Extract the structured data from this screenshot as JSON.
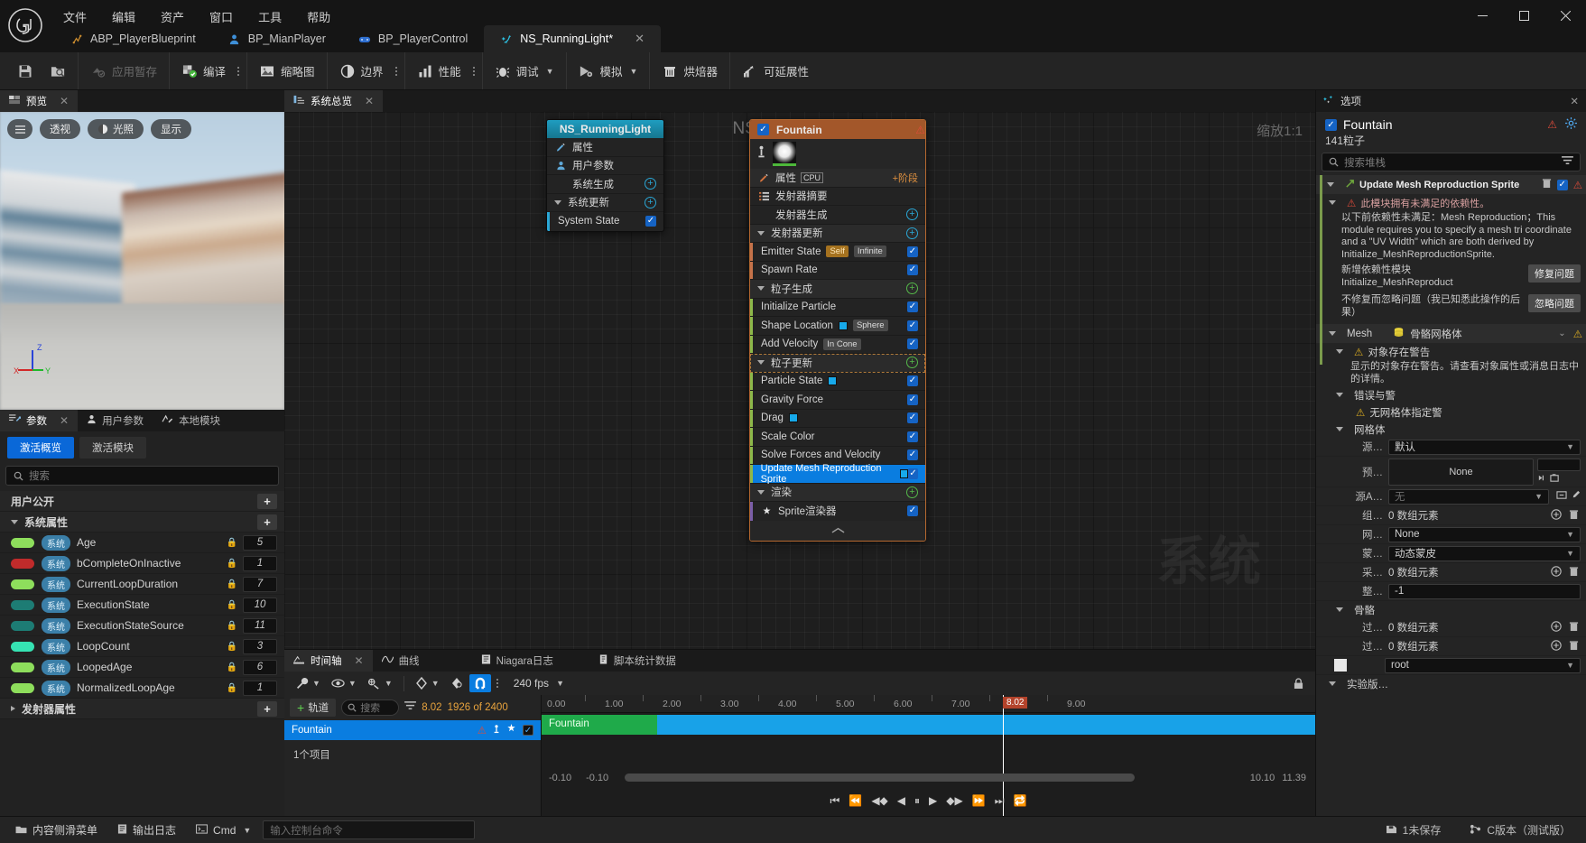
{
  "window": {
    "minimize": "—",
    "maximize": "▢",
    "close": "✕"
  },
  "menu": {
    "items": [
      {
        "label": "文件"
      },
      {
        "label": "编辑"
      },
      {
        "label": "资产"
      },
      {
        "label": "窗口"
      },
      {
        "label": "工具"
      },
      {
        "label": "帮助"
      }
    ]
  },
  "tabs": [
    {
      "label": "ABP_PlayerBlueprint",
      "icon": "anim-blueprint-icon",
      "active": false,
      "closable": false
    },
    {
      "label": "BP_MianPlayer",
      "icon": "blueprint-character-icon",
      "active": false,
      "closable": false
    },
    {
      "label": "BP_PlayerControl",
      "icon": "blueprint-controller-icon",
      "active": false,
      "closable": false
    },
    {
      "label": "NS_RunningLight*",
      "icon": "niagara-system-icon",
      "active": true,
      "closable": true,
      "close": "✕"
    }
  ],
  "toolbar": {
    "save_label": "",
    "save_icon": "save-icon",
    "browse_icon": "browse-to-asset-icon",
    "apply_label": "应用暂存",
    "apply_icon": "apply-scratch-icon",
    "compile_label": "编译",
    "compile_icon": "compile-check-icon",
    "thumbnail_label": "缩略图",
    "thumbnail_icon": "thumbnail-icon",
    "bounds_label": "边界",
    "bounds_icon": "bounds-icon",
    "performance_label": "性能",
    "performance_icon": "performance-bars-icon",
    "debug_label": "调试",
    "debug_icon": "debug-bug-icon",
    "simulate_label": "模拟",
    "simulate_icon": "simulate-play-icon",
    "baker_label": "烘焙器",
    "baker_icon": "baker-icon",
    "scalability_label": "可延展性",
    "scalability_icon": "scalability-graph-icon"
  },
  "preview": {
    "tab_label": "预览",
    "tab_icon": "viewport-icon",
    "close": "✕",
    "menu_icon": "hamburger-icon",
    "buttons": [
      {
        "label": "透视",
        "icon": ""
      },
      {
        "label": "光照",
        "icon": "lighting-icon"
      },
      {
        "label": "显示",
        "icon": ""
      }
    ],
    "axis": {
      "x": "X",
      "y": "Y",
      "z": "Z"
    }
  },
  "parameters": {
    "tabs": [
      {
        "label": "参数",
        "icon": "parameters-icon",
        "active": true,
        "close": "✕"
      },
      {
        "label": "用户参数",
        "icon": "user-icon",
        "active": false
      },
      {
        "label": "本地模块",
        "icon": "local-modules-icon",
        "active": false
      }
    ],
    "toggles": [
      {
        "label": "激活概览",
        "on": true
      },
      {
        "label": "激活模块",
        "on": false
      }
    ],
    "search_placeholder": "搜索",
    "search_icon": "search-icon",
    "sections": [
      {
        "title": "用户公开",
        "collapsed": true,
        "add": "+",
        "rows": []
      },
      {
        "title": "系统属性",
        "collapsed": false,
        "add": "+",
        "rows": [
          {
            "name": "Age",
            "tag": "系统",
            "color": "#8ede5c",
            "value": "5",
            "locked": true
          },
          {
            "name": "bCompleteOnInactive",
            "tag": "系统",
            "color": "#c02b2b",
            "value": "1",
            "locked": true
          },
          {
            "name": "CurrentLoopDuration",
            "tag": "系统",
            "color": "#8ede5c",
            "value": "7",
            "locked": true
          },
          {
            "name": "ExecutionState",
            "tag": "系统",
            "color": "#1d7c74",
            "value": "10",
            "locked": true
          },
          {
            "name": "ExecutionStateSource",
            "tag": "系统",
            "color": "#1d7c74",
            "value": "11",
            "locked": true
          },
          {
            "name": "LoopCount",
            "tag": "系统",
            "color": "#36e3b3",
            "value": "3",
            "locked": true
          },
          {
            "name": "LoopedAge",
            "tag": "系统",
            "color": "#8ede5c",
            "value": "6",
            "locked": true
          },
          {
            "name": "NormalizedLoopAge",
            "tag": "系统",
            "color": "#8ede5c",
            "value": "1",
            "locked": true
          }
        ]
      },
      {
        "title": "发射器属性",
        "collapsed": true,
        "add": "+",
        "rows": []
      }
    ]
  },
  "graph": {
    "tab_label": "系统总览",
    "tab_icon": "system-overview-icon",
    "close": "✕",
    "title": "NS_RunningLight",
    "zoom_label": "缩放1:1",
    "watermark": "系统",
    "system_node": {
      "title": "NS_RunningLight",
      "rows": [
        {
          "label": "属性",
          "icon": "pencil-icon",
          "type": "item"
        },
        {
          "label": "用户参数",
          "icon": "user-icon",
          "type": "item"
        },
        {
          "label": "系统生成",
          "icon": "",
          "type": "stage",
          "add": "+"
        },
        {
          "label": "系统更新",
          "icon": "",
          "type": "stage",
          "collapsed": false,
          "add": "+"
        },
        {
          "label": "System State",
          "icon": "",
          "type": "module",
          "checked": true
        }
      ]
    },
    "emitter_node": {
      "title": "Fountain",
      "checked": true,
      "warning_icon": "warning-triangle-icon",
      "thumbnail_icon": "particle-sprite-thumbnail",
      "rows": [
        {
          "label": "属性",
          "type": "item",
          "icon": "pencil-icon",
          "badge": "CPU",
          "stage_label": "阶段",
          "stage_add": "+"
        },
        {
          "label": "发射器摘要",
          "type": "item",
          "icon": "summary-icon"
        },
        {
          "label": "发射器生成",
          "type": "stage",
          "add": "+"
        },
        {
          "label": "发射器更新",
          "type": "stage",
          "collapsed": false,
          "add": "+"
        },
        {
          "label": "Emitter State",
          "type": "module",
          "badges": [
            "Self",
            "Infinite"
          ],
          "checked": true,
          "accent": "#c5724a"
        },
        {
          "label": "Spawn Rate",
          "type": "module",
          "checked": true,
          "accent": "#c5724a"
        },
        {
          "label": "粒子生成",
          "type": "stage",
          "collapsed": false,
          "add": "+"
        },
        {
          "label": "Initialize Particle",
          "type": "module",
          "checked": true,
          "accent": "#8cb84a"
        },
        {
          "label": "Shape Location",
          "type": "module",
          "badges": [
            "Sphere"
          ],
          "swatch": "#17a9ea",
          "checked": true,
          "accent": "#8cb84a"
        },
        {
          "label": "Add Velocity",
          "type": "module",
          "badges": [
            "In Cone"
          ],
          "checked": true,
          "accent": "#8cb84a"
        },
        {
          "label": "粒子更新",
          "type": "stage",
          "collapsed": false,
          "add": "+"
        },
        {
          "label": "Particle State",
          "type": "module",
          "swatch": "#17a9ea",
          "checked": true,
          "accent": "#8cb84a"
        },
        {
          "label": "Gravity Force",
          "type": "module",
          "checked": true,
          "accent": "#8cb84a"
        },
        {
          "label": "Drag",
          "type": "module",
          "swatch": "#17a9ea",
          "checked": true,
          "accent": "#8cb84a"
        },
        {
          "label": "Scale Color",
          "type": "module",
          "checked": true,
          "accent": "#8cb84a"
        },
        {
          "label": "Solve Forces and Velocity",
          "type": "module",
          "checked": true,
          "accent": "#8cb84a"
        },
        {
          "label": "Update Mesh Reproduction Sprite",
          "type": "module",
          "swatch": "#17a9ea",
          "checked": true,
          "selected": true,
          "accent": "#8cb84a"
        },
        {
          "label": "渲染",
          "type": "stage",
          "collapsed": false,
          "add": "+"
        },
        {
          "label": "Sprite渲染器",
          "type": "module",
          "icon": "sprite-renderer-icon",
          "checked": true,
          "accent": "#7a5ea8"
        }
      ],
      "collapse_icon": "chevron-up-icon"
    }
  },
  "timeline": {
    "tabs": [
      {
        "label": "时间轴",
        "icon": "timeline-icon",
        "active": true,
        "close": "✕"
      },
      {
        "label": "曲线",
        "icon": "curves-icon",
        "active": false
      },
      {
        "label": "Niagara日志",
        "icon": "log-icon",
        "active": false
      },
      {
        "label": "脚本统计数据",
        "icon": "script-stats-icon",
        "active": false
      }
    ],
    "toolbar": {
      "wrench_icon": "wrench-icon",
      "eye_icon": "eye-icon",
      "actions_icon": "actions-icon",
      "key_icon": "key-diamond-icon",
      "key2_icon": "key-interp-icon",
      "snap_icon": "snap-magnet-icon",
      "snap_on": true,
      "kebab_icon": "kebab-icon",
      "fps_label": "240 fps",
      "lock_icon": "lock-icon"
    },
    "left": {
      "add_track_label": "轨道",
      "add_track_plus": "+",
      "search_placeholder": "搜索",
      "filter_icon": "filter-icon",
      "current_time": "8.02",
      "frame_count": "1926 of 2400",
      "track_name": "Fountain",
      "track_icons": [
        "warning-triangle-icon",
        "isolate-icon",
        "solo-icon"
      ],
      "track_checked": true,
      "item_count": "1个项目"
    },
    "ruler_ticks": [
      "0.00",
      "1.00",
      "2.00",
      "3.00",
      "4.00",
      "5.00",
      "6.00",
      "7.00",
      "8.00",
      "9.00"
    ],
    "playhead_label": "8.02",
    "clip_label": "Fountain",
    "range_left": "-0.10",
    "range_left2": "-0.10",
    "range_right": "10.10",
    "range_right2": "11.39",
    "transport": [
      "⏮",
      "⏪",
      "◀◆",
      "◀",
      "⏸",
      "▶",
      "◆▶",
      "⏩",
      "⏭",
      "🔁"
    ]
  },
  "options": {
    "tab_label": "选项",
    "tab_icon": "niagara-options-icon",
    "close": "✕",
    "emitter_name": "Fountain",
    "warning_icon": "warning-triangle-icon",
    "gear_icon": "gear-icon",
    "particle_count": "141粒子",
    "search_placeholder": "搜索堆栈",
    "filter_icon": "filter-icon",
    "module": {
      "name": "Update Mesh Reproduction Sprite",
      "icon": "module-link-icon",
      "delete_icon": "trash-icon",
      "checked": true,
      "error": {
        "title": "此模块拥有未满足的依赖性。",
        "body": "以下前依赖性未满足：Mesh Reproduction；This module requires you to specify a mesh tri coordinate and a \"UV Width\" which are both derived by Initialize_MeshReproductionSprite.",
        "fix_label": "新增依赖性模块 Initialize_MeshReproduct",
        "fix_button": "修复问题",
        "ignore_label": "不修复而忽略问题（我已知悉此操作的后果）",
        "ignore_button": "忽略问题"
      }
    },
    "mesh_section": {
      "label": "Mesh",
      "value": "骨骼网格体",
      "icon": "mesh-icon",
      "chevron": "⌄",
      "warning_icon": "warning-triangle-icon"
    },
    "object_warning": {
      "title": "对象存在警告",
      "body": "显示的对象存在警告。请查看对象属性或消息日志中的详情。"
    },
    "errors_section": {
      "title": "错误与警",
      "item": "无网格体指定警"
    },
    "mesh_props": {
      "title": "网格体",
      "rows": [
        {
          "label": "源…",
          "value": "默认",
          "type": "combo"
        },
        {
          "label": "预…",
          "value": "None",
          "type": "asset",
          "picker_icons": [
            "browse-icon",
            "use-selected-icon"
          ]
        },
        {
          "label": "源A…",
          "value": "无",
          "type": "combo",
          "extra_icons": [
            "reset-icon",
            "eyedropper-icon"
          ]
        },
        {
          "label": "组…",
          "value": "0 数组元素",
          "type": "array",
          "icons": [
            "add-icon",
            "trash-icon"
          ]
        },
        {
          "label": "网…",
          "value": "None",
          "type": "combo"
        },
        {
          "label": "蒙…",
          "value": "动态蒙皮",
          "type": "combo"
        },
        {
          "label": "采…",
          "value": "0 数组元素",
          "type": "array",
          "icons": [
            "add-icon",
            "trash-icon"
          ]
        },
        {
          "label": "整…",
          "value": "-1",
          "type": "text"
        }
      ]
    },
    "skeleton_section": {
      "title": "骨骼",
      "rows": [
        {
          "label": "过…",
          "value": "0 数组元素",
          "type": "array",
          "icons": [
            "add-icon",
            "trash-icon"
          ]
        },
        {
          "label": "过…",
          "value": "0 数组元素",
          "type": "array",
          "icons": [
            "add-icon",
            "trash-icon"
          ]
        },
        {
          "label": "",
          "value": "root",
          "type": "combo",
          "swatch": "#e8e8e8"
        }
      ]
    },
    "experimental_section": {
      "title": "实验版…"
    }
  },
  "status": {
    "content_menu_label": "内容侧滑菜单",
    "content_menu_icon": "content-drawer-icon",
    "output_log_label": "输出日志",
    "output_log_icon": "output-log-icon",
    "cmd_label": "Cmd",
    "cmd_icon": "cmd-icon",
    "cmd_placeholder": "输入控制台命令",
    "unsaved_label": "1未保存",
    "unsaved_icon": "unsaved-icon",
    "version_label": "C版本（测试版）",
    "version_icon": "revision-icon"
  }
}
